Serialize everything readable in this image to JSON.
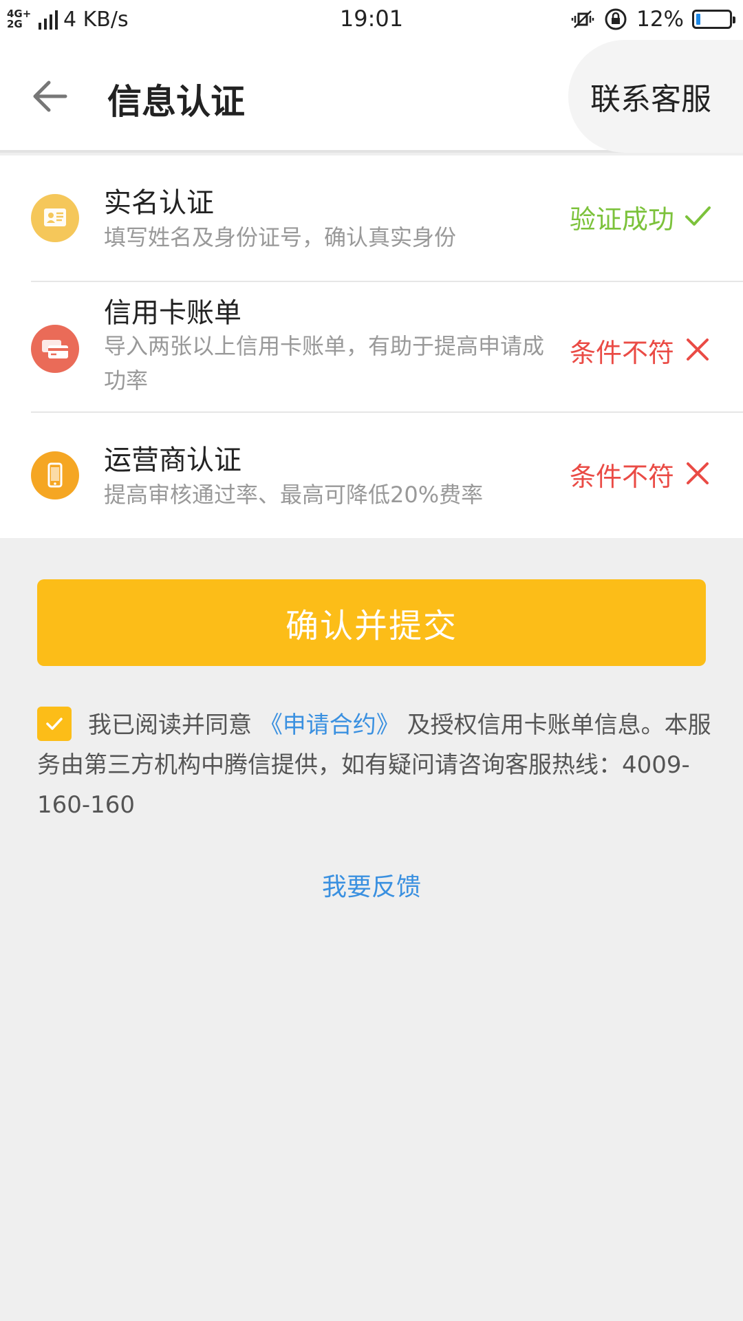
{
  "status_bar": {
    "network_top": "4G+",
    "network_bottom": "2G",
    "speed": "4 KB/s",
    "time": "19:01",
    "battery_percent": "12%",
    "battery_level": 0.12,
    "icons": [
      "vibrate-icon",
      "rotation-lock-icon",
      "battery-icon"
    ]
  },
  "header": {
    "title": "信息认证",
    "back_icon": "arrow-left-icon",
    "contact_label": "联系客服"
  },
  "items": [
    {
      "title": "实名认证",
      "desc": "填写姓名及身份证号，确认真实身份",
      "status": "验证成功",
      "status_type": "success",
      "icon": "id-card-icon",
      "icon_color": "#f5c75a"
    },
    {
      "title": "信用卡账单",
      "desc": "导入两张以上信用卡账单，有助于提高申请成功率",
      "status": "条件不符",
      "status_type": "fail",
      "icon": "credit-card-icon",
      "icon_color": "#ea6b58"
    },
    {
      "title": "运营商认证",
      "desc": "提高审核通过率、最高可降低20%费率",
      "status": "条件不符",
      "status_type": "fail",
      "icon": "phone-icon",
      "icon_color": "#f5a623"
    }
  ],
  "submit_label": "确认并提交",
  "agreement": {
    "checked": true,
    "prefix": "我已阅读并同意 ",
    "link": "《申请合约》",
    "suffix": " 及授权信用卡账单信息。本服务由第三方机构中腾信提供，如有疑问请咨询客服热线：4009-160-160"
  },
  "feedback_label": "我要反馈",
  "colors": {
    "accent": "#fcbd18",
    "success": "#7cc23b",
    "fail": "#ea4b45",
    "link": "#3a90e0"
  }
}
